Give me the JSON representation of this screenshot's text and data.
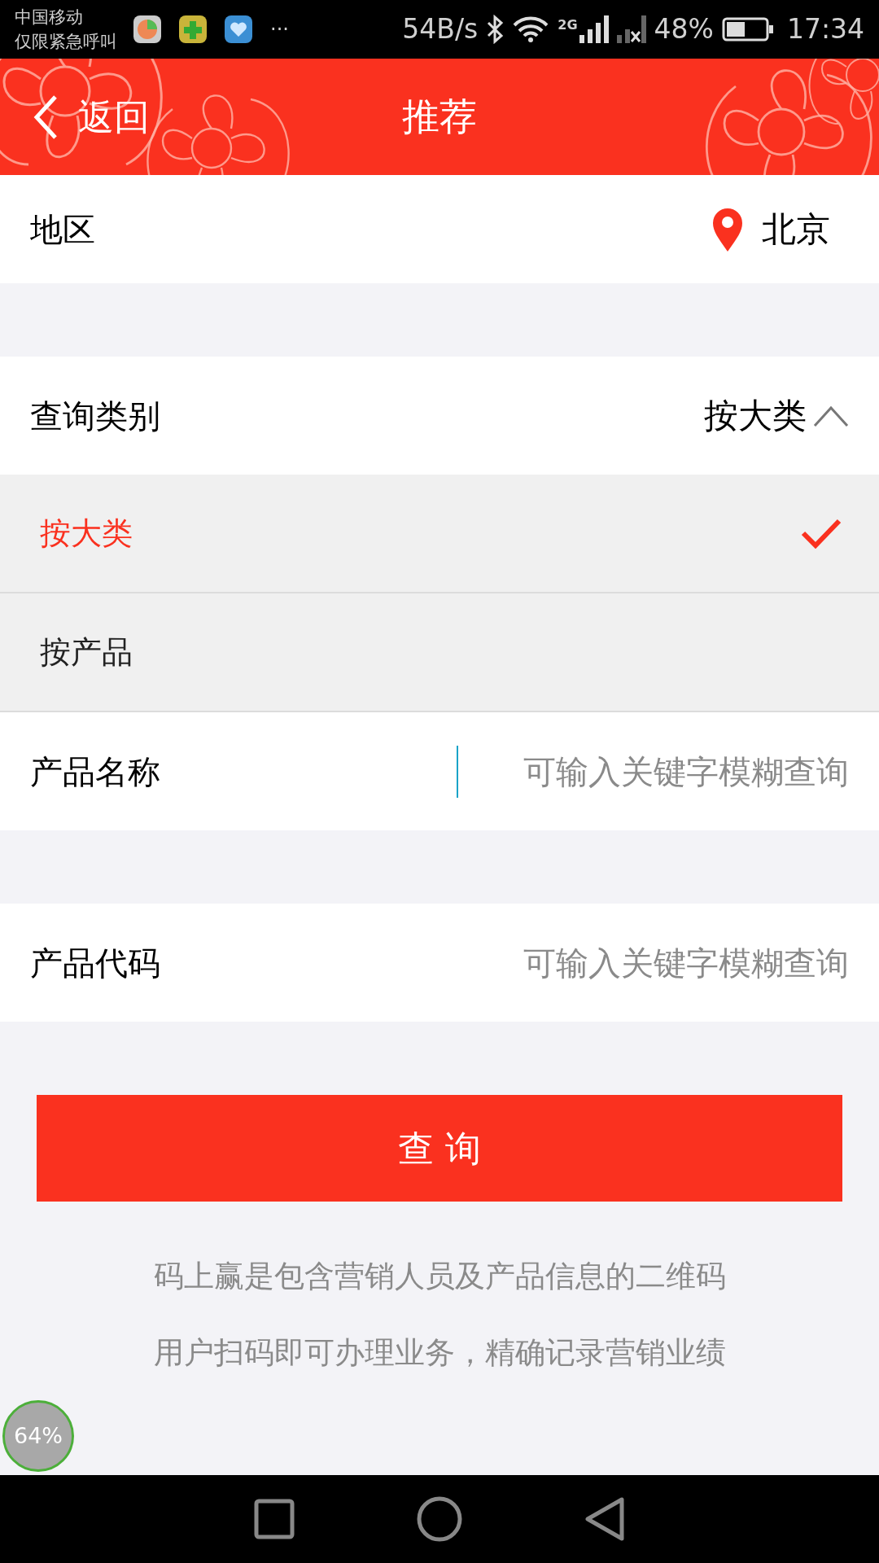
{
  "status_bar": {
    "carrier": "中国移动",
    "carrier_note": "仅限紧急呼叫",
    "more": "···",
    "speed": "54B/s",
    "network": "2G",
    "battery": "48%",
    "time": "17:34"
  },
  "header": {
    "back": "返回",
    "title": "推荐"
  },
  "region": {
    "label": "地区",
    "value": "北京"
  },
  "query_type": {
    "label": "查询类别",
    "value": "按大类",
    "expanded": true,
    "options": [
      {
        "label": "按大类",
        "selected": true
      },
      {
        "label": "按产品",
        "selected": false
      }
    ]
  },
  "product_name": {
    "label": "产品名称",
    "placeholder": "可输入关键字模糊查询",
    "focused": true
  },
  "product_code": {
    "label": "产品代码",
    "placeholder": "可输入关键字模糊查询",
    "focused": false
  },
  "query_button": "查 询",
  "info_lines": [
    "码上赢是包含营销人员及产品信息的二维码",
    "用户扫码即可办理业务，精确记录营销业绩"
  ],
  "float_badge": "64%"
}
